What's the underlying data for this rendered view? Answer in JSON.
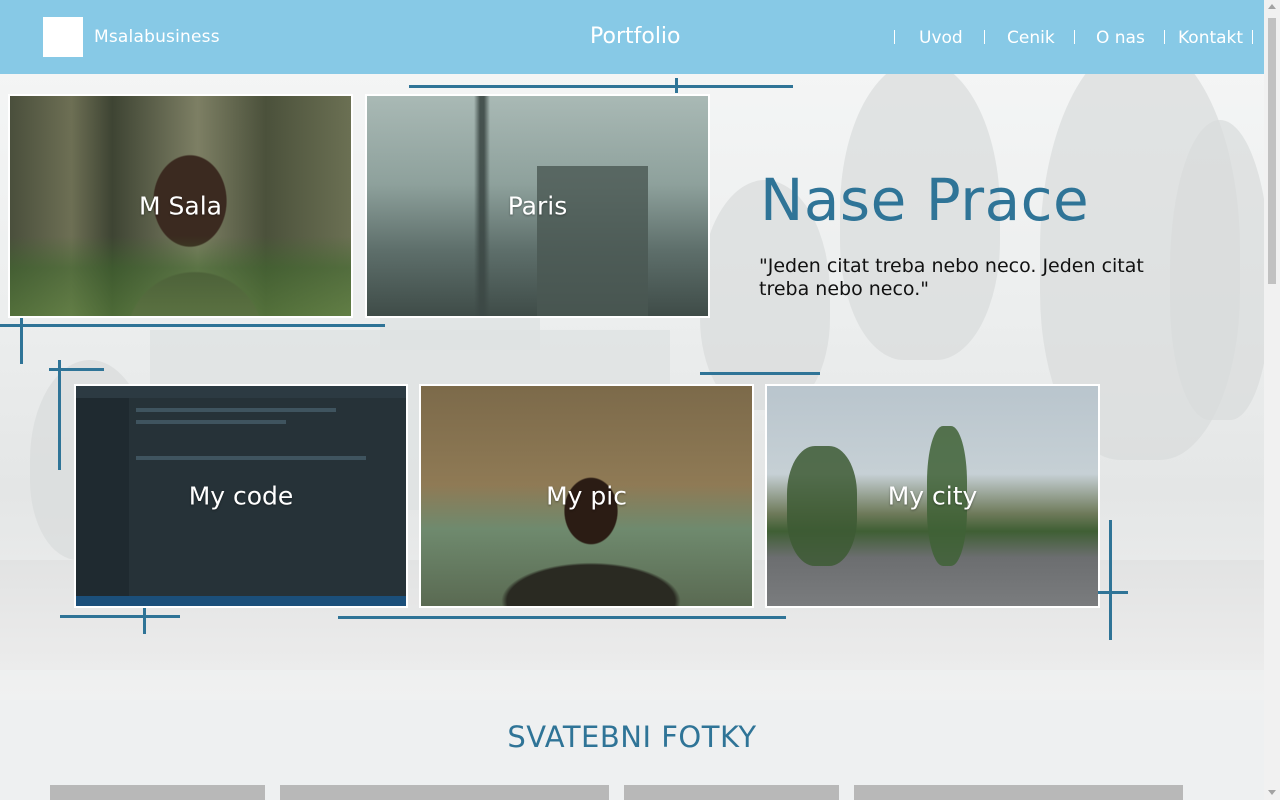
{
  "header": {
    "brand": "Msalabusiness",
    "page_title": "Portfolio",
    "nav": [
      "Uvod",
      "Cenik",
      "O nas",
      "Kontakt"
    ]
  },
  "hero": {
    "heading": "Nase Prace",
    "quote": "\"Jeden citat treba nebo neco. Jeden citat treba nebo neco.\""
  },
  "cards": [
    {
      "label": "M Sala"
    },
    {
      "label": "Paris"
    },
    {
      "label": "My code"
    },
    {
      "label": "My pic"
    },
    {
      "label": "My city"
    }
  ],
  "section": {
    "title": "SVATEBNI FOTKY"
  },
  "colors": {
    "header": "#87c9e6",
    "accent": "#2f7497"
  }
}
